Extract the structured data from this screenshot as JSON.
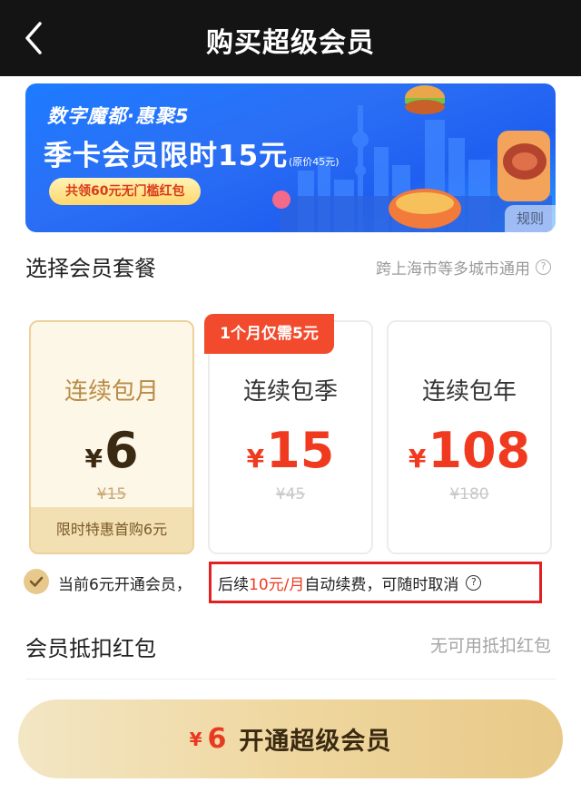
{
  "header": {
    "title": "购买超级会员",
    "back_icon": "chevron-left-icon"
  },
  "banner": {
    "brand": "数字魔都·惠聚5",
    "headline": "季卡会员限时15元",
    "original_price": "(原价45元)",
    "coupon_pill": "共领60元无门槛红包",
    "rules_label": "规则"
  },
  "plans": {
    "section_title": "选择会员套餐",
    "coverage_note": "跨上海市等多城市通用",
    "items": [
      {
        "name": "连续包月",
        "currency": "¥",
        "price": "6",
        "original": "¥15",
        "footer": "限时特惠首购6元",
        "selected": true
      },
      {
        "name": "连续包季",
        "currency": "¥",
        "price": "15",
        "original": "¥45",
        "promo_tag": "1个月仅需5元"
      },
      {
        "name": "连续包年",
        "currency": "¥",
        "price": "108",
        "original": "¥180"
      }
    ]
  },
  "agreement": {
    "prefix": "当前6元开通会员，",
    "renew_before": "后续",
    "renew_price": "10元/月",
    "renew_after": "自动续费，可随时取消"
  },
  "red_packet": {
    "label": "会员抵扣红包",
    "value": "无可用抵扣红包"
  },
  "cta": {
    "currency": "¥",
    "amount": "6",
    "label": "开通超级会员"
  },
  "colors": {
    "accent_red": "#f03a20",
    "gold": "#e7c98d",
    "topbar": "#141414",
    "highlight_border": "#e22222"
  }
}
